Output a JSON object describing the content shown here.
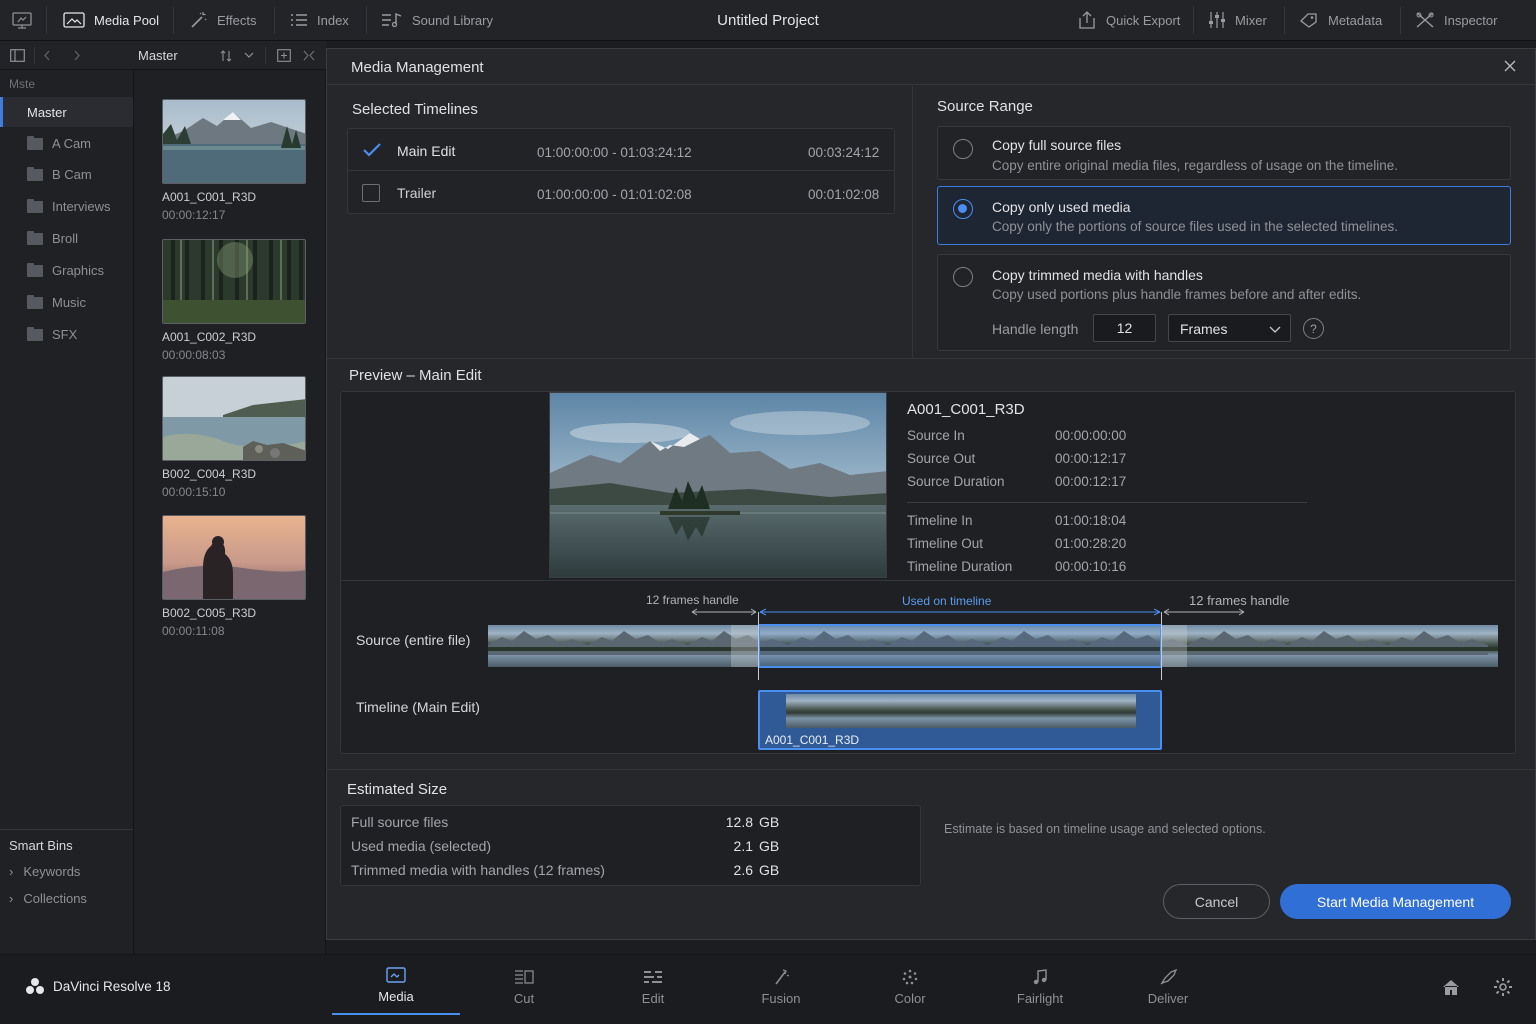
{
  "topbar": {
    "media_pool": "Media Pool",
    "effects": "Effects",
    "index": "Index",
    "sound_library": "Sound Library",
    "project_title": "Untitled Project",
    "quick_export": "Quick Export",
    "mixer": "Mixer",
    "metadata": "Metadata",
    "inspector": "Inspector"
  },
  "sidebar": {
    "bin_header": "Master",
    "filter_label": "Mste",
    "master": "Master",
    "folders": [
      "A Cam",
      "B Cam",
      "Interviews",
      "Broll",
      "Graphics",
      "Music",
      "SFX"
    ],
    "smart_bins": "Smart Bins",
    "keywords": "Keywords",
    "collections": "Collections"
  },
  "clips": [
    {
      "name": "A001_C001_R3D",
      "duration": "00:00:12:17"
    },
    {
      "name": "A001_C002_R3D",
      "duration": "00:00:08:03"
    },
    {
      "name": "B002_C004_R3D",
      "duration": "00:00:15:10"
    },
    {
      "name": "B002_C005_R3D",
      "duration": "00:00:11:08"
    }
  ],
  "dialog": {
    "title": "Media Management",
    "selected_timelines_title": "Selected Timelines",
    "timelines": [
      {
        "name": "Main Edit",
        "range": "01:00:00:00 - 01:03:24:12",
        "duration": "00:03:24:12",
        "checked": true
      },
      {
        "name": "Trailer",
        "range": "01:00:00:00 - 01:01:02:08",
        "duration": "00:01:02:08",
        "checked": false
      }
    ],
    "source_range_title": "Source Range",
    "options": [
      {
        "title": "Copy full source files",
        "desc": "Copy entire original media files, regardless of usage on the timeline.",
        "selected": false
      },
      {
        "title": "Copy only used media",
        "desc": "Copy only the portions of source files used in the selected timelines.",
        "selected": true
      },
      {
        "title": "Copy trimmed media with handles",
        "desc": "Copy used portions plus handle frames before and after edits.",
        "selected": false
      }
    ],
    "handle_length_label": "Handle length",
    "handle_length_value": "12",
    "handle_unit": "Frames",
    "help": "?",
    "preview_title": "Preview – Main Edit",
    "preview_clip": {
      "name": "A001_C001_R3D",
      "source_in_label": "Source In",
      "source_in": "00:00:00:00",
      "source_out_label": "Source Out",
      "source_out": "00:00:12:17",
      "source_duration_label": "Source Duration",
      "source_duration": "00:00:12:17",
      "timeline_in_label": "Timeline In",
      "timeline_in": "01:00:18:04",
      "timeline_out_label": "Timeline Out",
      "timeline_out": "01:00:28:20",
      "timeline_duration_label": "Timeline Duration",
      "timeline_duration": "00:00:10:16"
    },
    "diagram": {
      "handle_left": "12 frames handle",
      "used": "Used on timeline",
      "handle_right": "12 frames handle",
      "source_label": "Source (entire file)",
      "timeline_label": "Timeline (Main Edit)",
      "timeline_clip": "A001_C001_R3D"
    },
    "estimated_size_title": "Estimated Size",
    "sizes": [
      {
        "label": "Full source files",
        "value": "12.8",
        "unit": "GB"
      },
      {
        "label": "Used media (selected)",
        "value": "2.1",
        "unit": "GB"
      },
      {
        "label": "Trimmed media with handles (12 frames)",
        "value": "2.6",
        "unit": "GB"
      }
    ],
    "estimate_note": "Estimate is based on timeline usage and selected options.",
    "cancel": "Cancel",
    "start": "Start Media Management"
  },
  "bottom": {
    "app_name": "DaVinci Resolve 18",
    "tabs": [
      "Media",
      "Cut",
      "Edit",
      "Fusion",
      "Color",
      "Fairlight",
      "Deliver"
    ],
    "active_tab": "Media"
  },
  "colors": {
    "accent": "#3d7de0",
    "button_primary": "#2f6fd6",
    "background": "#1c1d20"
  }
}
